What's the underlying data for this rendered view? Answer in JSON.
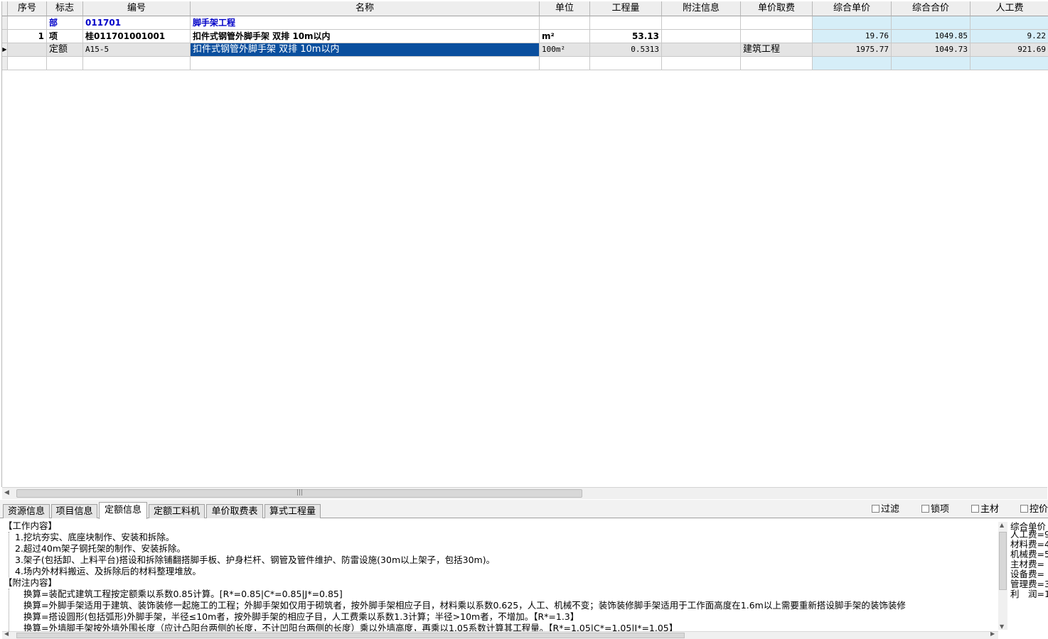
{
  "grid": {
    "columns": [
      "序号",
      "标志",
      "编号",
      "名称",
      "单位",
      "工程量",
      "附注信息",
      "单价取费",
      "综合单价",
      "综合合价",
      "人工费"
    ],
    "rows": [
      {
        "seq": "",
        "flag": "部",
        "code": "011701",
        "name": "脚手架工程",
        "unit": "",
        "qty": "",
        "note": "",
        "fee": "",
        "unit_price": "",
        "total": "",
        "labor": ""
      },
      {
        "seq": "1",
        "flag": "项",
        "code": "桂011701001001",
        "name": "扣件式钢管外脚手架 双排 10m以内",
        "unit": "m²",
        "qty": "53.13",
        "note": "",
        "fee": "",
        "unit_price": "19.76",
        "total": "1049.85",
        "labor": "9.22"
      },
      {
        "seq": "",
        "flag": "定额",
        "code": "A15-5",
        "name": "扣件式钢管外脚手架 双排 10m以内",
        "unit": "100m²",
        "qty": "0.5313",
        "note": "",
        "fee": "建筑工程",
        "unit_price": "1975.77",
        "total": "1049.73",
        "labor": "921.69"
      },
      {
        "seq": "",
        "flag": "",
        "code": "",
        "name": "",
        "unit": "",
        "qty": "",
        "note": "",
        "fee": "",
        "unit_price": "",
        "total": "",
        "labor": ""
      }
    ]
  },
  "tabs": [
    "资源信息",
    "项目信息",
    "定额信息",
    "定额工料机",
    "单价取费表",
    "算式工程量"
  ],
  "active_tab": "定额信息",
  "checkboxes": [
    "过滤",
    "锁项",
    "主材",
    "控价"
  ],
  "info": {
    "work_title": "【工作内容】",
    "work_items": [
      "1.挖坑夯实、底座块制作、安装和拆除。",
      "2.超过40m架子钢托架的制作、安装拆除。",
      "3.架子(包括卸、上料平台)搭设和拆除铺翻搭脚手板、护身栏杆、钢管及管件维护、防雷设施(30m以上架子，包括30m)。",
      "4.场内外材料搬运、及拆除后的材料整理堆放。"
    ],
    "note_title": "【附注内容】",
    "note_items": [
      "换算=装配式建筑工程按定额乘以系数0.85计算。[R*=0.85|C*=0.85|J*=0.85]",
      "换算=外脚手架适用于建筑、装饰装修一起施工的工程；外脚手架如仅用于砌筑者，按外脚手架相应子目，材料乘以系数0.625，人工、机械不变；装饰装修脚手架适用于工作面高度在1.6m以上需要重新搭设脚手架的装饰装修",
      "换算=搭设圆形(包括弧形)外脚手架，半径≤10m者，按外脚手架的相应子目，人工费乘以系数1.3计算；半径>10m者，不增加。【R*=1.3】",
      "换算=外墙脚手架按外墙外围长度（应计凸阳台两侧的长度，不计凹阳台两侧的长度）乘以外墙高度，再乘以1.05系数计算其工程量。【R*=1.05|C*=1.05|J*=1.05】"
    ]
  },
  "side": [
    "综合单价",
    "人工费=9",
    "材料费=4",
    "机械费=5",
    "主材费=",
    "设备费=",
    "管理费=3",
    "利　润=1"
  ]
}
